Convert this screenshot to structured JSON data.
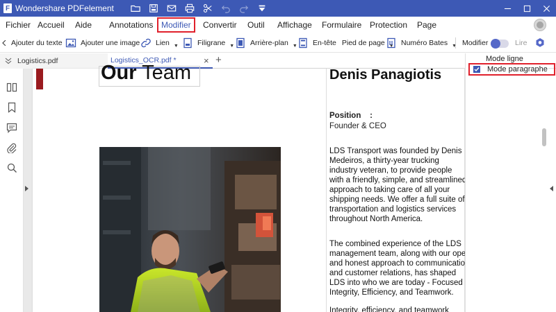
{
  "app": {
    "title": "Wondershare PDFelement",
    "logo_letter": "F"
  },
  "menu": {
    "items": [
      "Fichier",
      "Accueil",
      "Aide",
      "Annotations",
      "Modifier",
      "Convertir",
      "Outil",
      "Affichage",
      "Formulaire",
      "Protection",
      "Page"
    ],
    "active": "Modifier"
  },
  "toolbar": {
    "add_text": "Ajouter du texte",
    "add_image": "Ajouter une image",
    "link": "Lien",
    "watermark": "Filigrane",
    "background": "Arrière-plan",
    "header": "En-tête",
    "footer": "Pied de page",
    "bates": "Numéro Bates",
    "modify": "Modifier",
    "read": "Lire"
  },
  "tabs": {
    "items": [
      {
        "label": "Logistics.pdf",
        "active": false
      },
      {
        "label": "Logistics_OCR.pdf *",
        "active": true
      }
    ],
    "close_glyph": "×",
    "add_glyph": "+"
  },
  "panel": {
    "line_mode": "Mode ligne",
    "paragraph_mode": "Mode paragraphe",
    "paragraph_checked": true
  },
  "document": {
    "heading_bold": "Our",
    "heading_rest": " Team",
    "name": "Denis Panagiotis",
    "position_label": "Position    :",
    "position_value": "Founder & CEO",
    "paragraph1": [
      "LDS Transport was founded by Denis",
      "Medeiros, a thirty-year trucking",
      "industry veteran, to provide people",
      "with a friendly, simple, and streamlined",
      "approach to taking care of all your",
      "shipping needs. We offer a full suite of",
      "transportation and logistics services",
      "throughout North America."
    ],
    "paragraph2": [
      "The combined experience of the LDS",
      "management team, along with our open",
      "and honest approach to communication",
      "and customer relations, has shaped",
      "LDS into who we are today - Focused on",
      "Integrity, Efficiency, and Teamwork."
    ],
    "paragraph3": [
      "Integrity, efficiency, and teamwork"
    ]
  },
  "colors": {
    "brand": "#3d59b5",
    "highlight": "#e0202b",
    "accent_bar": "#9a1b1f"
  },
  "icons": {
    "titlebar": [
      "folder-icon",
      "save-icon",
      "mail-icon",
      "print-icon",
      "scissors-icon",
      "undo-icon",
      "redo-icon",
      "dropdown-icon"
    ],
    "sidebar": [
      "thumbnails-icon",
      "bookmark-icon",
      "comment-icon",
      "attachment-icon",
      "search-icon"
    ]
  }
}
